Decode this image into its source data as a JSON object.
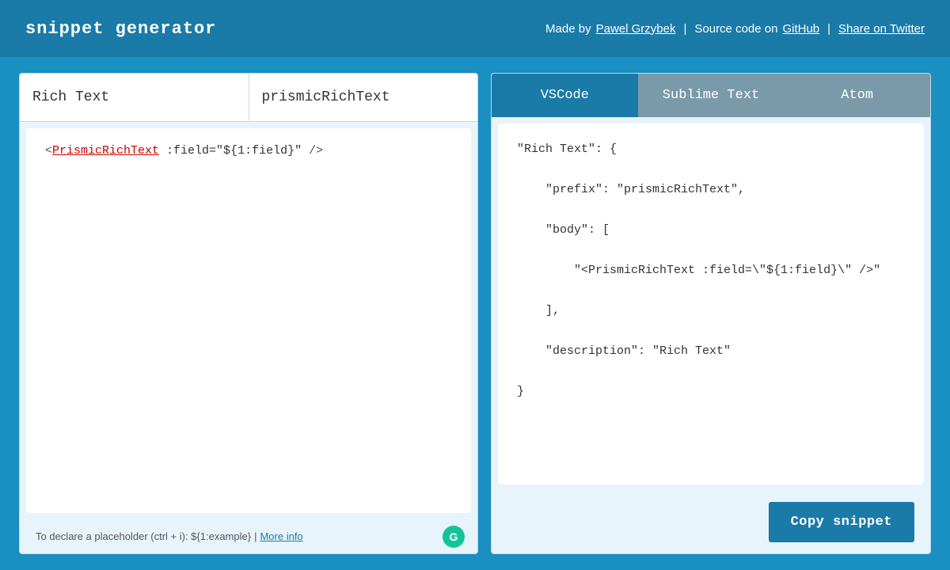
{
  "header": {
    "title": "snippet generator",
    "made_by_text": "Made by",
    "author_name": "Pawel Grzybek",
    "separator1": "|",
    "source_text": "Source code on",
    "github_label": "GitHub",
    "separator2": "|",
    "twitter_label": "Share on Twitter"
  },
  "left_panel": {
    "field1_value": "Rich Text",
    "field1_placeholder": "Rich Text",
    "field2_value": "prismicRichText",
    "field2_placeholder": "prismicRichText",
    "code_content": "<PrismicRichText :field=\"${1:field}\" />",
    "footer_text": "To declare a placeholder (ctrl + i): ${1:example}",
    "footer_separator": "|",
    "footer_link": "More info"
  },
  "right_panel": {
    "tabs": [
      {
        "id": "vscode",
        "label": "VSCode",
        "active": true
      },
      {
        "id": "sublime",
        "label": "Sublime Text",
        "active": false
      },
      {
        "id": "atom",
        "label": "Atom",
        "active": false
      }
    ],
    "snippet": "\"Rich Text\": {\n\n    \"prefix\": \"prismicRichText\",\n\n    \"body\": [\n\n        \"<PrismicRichText :field=\\\"${1:field}\\\" />\"\n\n    ],\n\n    \"description\": \"Rich Text\"\n\n}",
    "copy_button_label": "Copy snippet"
  }
}
